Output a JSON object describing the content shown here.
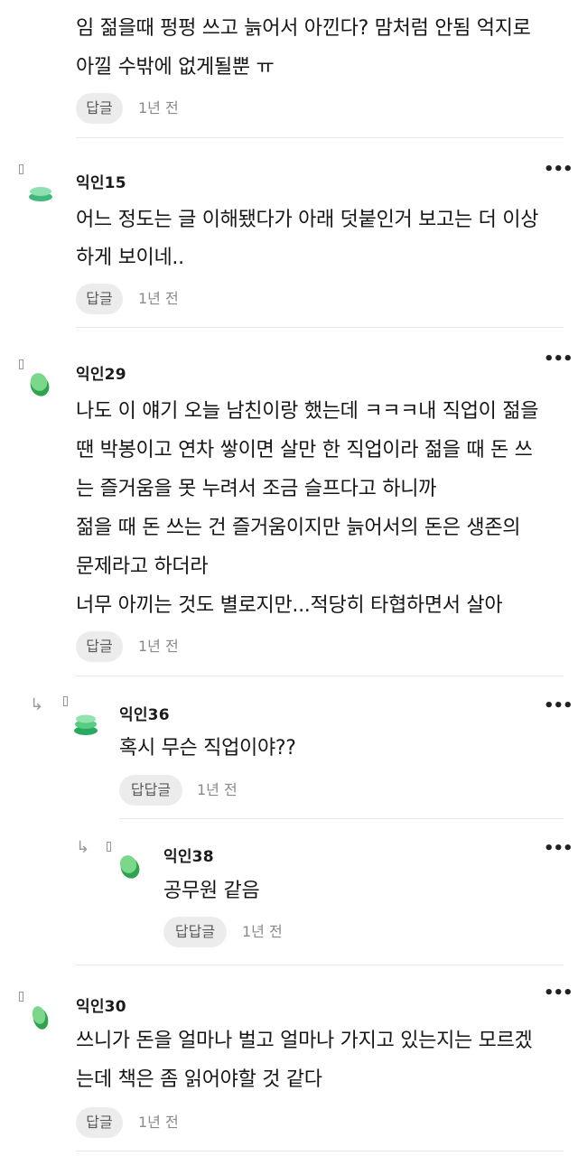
{
  "comments": [
    {
      "id": "c0",
      "lines": [
        "임 젊을때 펑펑 쓰고 늙어서 아낀다? 맘처럼 안됨 억지로",
        "아낄 수밖에 없게될뿐 ㅠ"
      ],
      "reply_label": "답글",
      "time": "1년 전"
    },
    {
      "id": "c1",
      "nickname": "익인15",
      "lines": [
        "어느 정도는 글 이해됐다가 아래 덧붙인거 보고는 더 이상",
        "하게 보이네.."
      ],
      "reply_label": "답글",
      "time": "1년 전",
      "avatar_color": "#6bd49a",
      "avatar_shape": "stacked-discs"
    },
    {
      "id": "c2",
      "nickname": "익인29",
      "lines": [
        "나도 이 얘기 오늘 남친이랑 했는데 ㅋㅋㅋ내 직업이 젊을",
        "땐 박봉이고 연차 쌓이면 살만 한 직업이라 젊을 때 돈 쓰",
        "는 즐거움을 못 누려서 조금 슬프다고 하니까",
        "젊을 때 돈 쓰는 건 즐거움이지만 늙어서의 돈은 생존의",
        "문제라고 하더라",
        "너무 아끼는 것도 별로지만...적당히 타협하면서 살아"
      ],
      "reply_label": "답글",
      "time": "1년 전",
      "avatar_color": "#4cc36a",
      "avatar_shape": "leaf-ball"
    },
    {
      "id": "c3",
      "nickname": "익인36",
      "lines": [
        "혹시 무슨 직업이야??"
      ],
      "reply_label": "답답글",
      "time": "1년 전",
      "avatar_color": "#3fc178",
      "avatar_shape": "stacked-discs"
    },
    {
      "id": "c4",
      "nickname": "익인38",
      "lines": [
        "공무원 같음"
      ],
      "reply_label": "답답글",
      "time": "1년 전",
      "avatar_color": "#47c26b",
      "avatar_shape": "leaf-ball"
    },
    {
      "id": "c5",
      "nickname": "익인30",
      "lines": [
        "쓰니가 돈을 얼마나 벌고 얼마나 가지고 있는지는 모르겠",
        "는데 책은 좀 읽어야할 것 같다"
      ],
      "reply_label": "답글",
      "time": "1년 전",
      "avatar_color": "#4cc36a",
      "avatar_shape": "leaf-ball"
    }
  ],
  "icons": {
    "more": "more-dots-icon",
    "reply_arrow": "reply-arrow-icon"
  },
  "glyphs": {
    "more": "•••",
    "reply_arrow": "↳"
  }
}
